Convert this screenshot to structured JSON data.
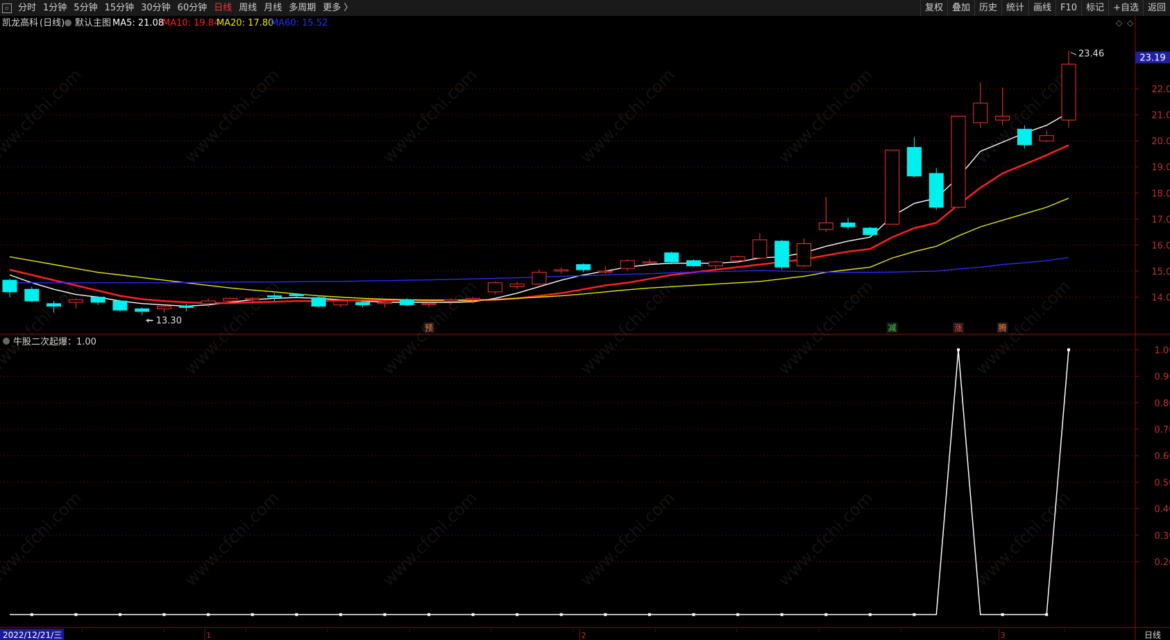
{
  "toolbar": {
    "tabs": [
      "分时",
      "1分钟",
      "5分钟",
      "15分钟",
      "30分钟",
      "60分钟",
      "日线",
      "周线",
      "月线",
      "多周期",
      "更多 〉"
    ],
    "active_tab": "日线",
    "right_buttons": [
      "复权",
      "叠加",
      "历史",
      "统计",
      "画线",
      "F10",
      "标记",
      "+自选",
      "返回"
    ]
  },
  "main_panel": {
    "stock_name": "凯龙高科",
    "period": "(日线)",
    "template_label": "默认主图",
    "ma_labels": [
      {
        "text": "MA5: 21.08",
        "color": "#ffffff"
      },
      {
        "text": "MA10: 19.84",
        "color": "#ff2020"
      },
      {
        "text": "MA20: 17.80",
        "color": "#e8e800"
      },
      {
        "text": "MA60: 15.52",
        "color": "#2a2aff"
      }
    ],
    "current_price_tag": "23.19",
    "high_marker": "23.46",
    "low_marker": "13.30",
    "signals": [
      {
        "text": "预",
        "color": "#ff8040"
      },
      {
        "text": "减",
        "color": "#40d040"
      },
      {
        "text": "涨",
        "color": "#ff4040"
      },
      {
        "text": "腾",
        "color": "#ff8040"
      }
    ]
  },
  "sub_panel": {
    "indicator_label": "牛股二次起爆：1.00"
  },
  "bottom_bar": {
    "date": "2022/12/21/三",
    "month_marks": [
      "1",
      "2",
      "3"
    ],
    "period_label": "日线"
  },
  "watermark": "www.cfchi.com",
  "chart_data": [
    {
      "type": "candlestick",
      "title": "凯龙高科 (日线)",
      "y_axis_ticks": [
        14.0,
        15.0,
        16.0,
        17.0,
        18.0,
        19.0,
        20.0,
        21.0,
        22.0
      ],
      "ylim": [
        13.0,
        24.0
      ],
      "candles": [
        {
          "o": 14.65,
          "h": 14.7,
          "l": 14.0,
          "c": 14.2
        },
        {
          "o": 14.3,
          "h": 14.4,
          "l": 13.8,
          "c": 13.85
        },
        {
          "o": 13.75,
          "h": 13.85,
          "l": 13.4,
          "c": 13.65
        },
        {
          "o": 13.8,
          "h": 13.95,
          "l": 13.55,
          "c": 13.9
        },
        {
          "o": 14.0,
          "h": 14.05,
          "l": 13.7,
          "c": 13.8
        },
        {
          "o": 13.85,
          "h": 13.9,
          "l": 13.45,
          "c": 13.5
        },
        {
          "o": 13.55,
          "h": 13.6,
          "l": 13.3,
          "c": 13.45
        },
        {
          "o": 13.55,
          "h": 13.7,
          "l": 13.4,
          "c": 13.65
        },
        {
          "o": 13.65,
          "h": 13.75,
          "l": 13.45,
          "c": 13.6
        },
        {
          "o": 13.75,
          "h": 13.95,
          "l": 13.6,
          "c": 13.85
        },
        {
          "o": 13.85,
          "h": 13.98,
          "l": 13.75,
          "c": 13.95
        },
        {
          "o": 13.9,
          "h": 14.0,
          "l": 13.75,
          "c": 13.95
        },
        {
          "o": 14.05,
          "h": 14.15,
          "l": 13.85,
          "c": 14.0
        },
        {
          "o": 14.1,
          "h": 14.15,
          "l": 13.95,
          "c": 14.05
        },
        {
          "o": 13.98,
          "h": 14.05,
          "l": 13.6,
          "c": 13.65
        },
        {
          "o": 13.7,
          "h": 13.9,
          "l": 13.6,
          "c": 13.85
        },
        {
          "o": 13.8,
          "h": 13.9,
          "l": 13.6,
          "c": 13.7
        },
        {
          "o": 13.75,
          "h": 13.85,
          "l": 13.6,
          "c": 13.8
        },
        {
          "o": 13.9,
          "h": 13.95,
          "l": 13.65,
          "c": 13.7
        },
        {
          "o": 13.75,
          "h": 13.8,
          "l": 13.6,
          "c": 13.75
        },
        {
          "o": 13.85,
          "h": 13.95,
          "l": 13.7,
          "c": 13.9
        },
        {
          "o": 13.9,
          "h": 14.0,
          "l": 13.75,
          "c": 13.95
        },
        {
          "o": 14.2,
          "h": 14.6,
          "l": 14.1,
          "c": 14.55
        },
        {
          "o": 14.4,
          "h": 14.6,
          "l": 14.3,
          "c": 14.5
        },
        {
          "o": 14.5,
          "h": 15.05,
          "l": 14.45,
          "c": 14.95
        },
        {
          "o": 15.0,
          "h": 15.15,
          "l": 14.9,
          "c": 15.05
        },
        {
          "o": 15.25,
          "h": 15.3,
          "l": 14.95,
          "c": 15.05
        },
        {
          "o": 15.0,
          "h": 15.2,
          "l": 14.9,
          "c": 15.0
        },
        {
          "o": 15.1,
          "h": 15.45,
          "l": 15.0,
          "c": 15.4
        },
        {
          "o": 15.35,
          "h": 15.45,
          "l": 15.25,
          "c": 15.35
        },
        {
          "o": 15.7,
          "h": 15.75,
          "l": 15.25,
          "c": 15.35
        },
        {
          "o": 15.4,
          "h": 15.45,
          "l": 15.15,
          "c": 15.2
        },
        {
          "o": 15.2,
          "h": 15.4,
          "l": 15.1,
          "c": 15.35
        },
        {
          "o": 15.4,
          "h": 15.6,
          "l": 15.3,
          "c": 15.55
        },
        {
          "o": 15.5,
          "h": 16.45,
          "l": 15.45,
          "c": 16.2
        },
        {
          "o": 16.15,
          "h": 16.2,
          "l": 15.05,
          "c": 15.15
        },
        {
          "o": 15.2,
          "h": 16.25,
          "l": 15.15,
          "c": 16.05
        },
        {
          "o": 16.6,
          "h": 17.85,
          "l": 16.5,
          "c": 16.85
        },
        {
          "o": 16.85,
          "h": 17.05,
          "l": 16.6,
          "c": 16.7
        },
        {
          "o": 16.65,
          "h": 16.7,
          "l": 16.35,
          "c": 16.4
        },
        {
          "o": 16.8,
          "h": 19.65,
          "l": 16.8,
          "c": 19.65
        },
        {
          "o": 19.75,
          "h": 20.15,
          "l": 18.6,
          "c": 18.65
        },
        {
          "o": 18.75,
          "h": 18.95,
          "l": 17.35,
          "c": 17.45
        },
        {
          "o": 17.45,
          "h": 20.95,
          "l": 17.4,
          "c": 20.95
        },
        {
          "o": 20.7,
          "h": 22.25,
          "l": 20.5,
          "c": 21.45
        },
        {
          "o": 20.8,
          "h": 22.05,
          "l": 20.6,
          "c": 20.95
        },
        {
          "o": 20.45,
          "h": 20.6,
          "l": 19.7,
          "c": 19.85
        },
        {
          "o": 20.0,
          "h": 20.4,
          "l": 19.95,
          "c": 20.2
        },
        {
          "o": 20.8,
          "h": 23.46,
          "l": 20.5,
          "c": 22.95
        }
      ],
      "series": [
        {
          "name": "MA5",
          "color": "#ffffff",
          "values": [
            14.85,
            14.55,
            14.3,
            14.1,
            14.0,
            13.85,
            13.75,
            13.7,
            13.65,
            13.7,
            13.8,
            13.9,
            13.95,
            13.98,
            13.95,
            13.9,
            13.85,
            13.8,
            13.8,
            13.8,
            13.8,
            13.82,
            13.95,
            14.15,
            14.4,
            14.65,
            14.85,
            15.0,
            15.15,
            15.25,
            15.3,
            15.3,
            15.3,
            15.35,
            15.5,
            15.55,
            15.7,
            15.95,
            16.15,
            16.3,
            17.1,
            17.6,
            17.8,
            18.6,
            19.6,
            19.95,
            20.3,
            20.6,
            21.08
          ]
        },
        {
          "name": "MA10",
          "color": "#ff2020",
          "values": [
            15.05,
            14.85,
            14.65,
            14.45,
            14.25,
            14.05,
            13.92,
            13.85,
            13.8,
            13.77,
            13.77,
            13.8,
            13.82,
            13.85,
            13.85,
            13.88,
            13.88,
            13.88,
            13.88,
            13.88,
            13.88,
            13.88,
            13.9,
            13.95,
            14.05,
            14.15,
            14.3,
            14.45,
            14.55,
            14.7,
            14.85,
            14.95,
            15.05,
            15.15,
            15.25,
            15.35,
            15.45,
            15.6,
            15.75,
            15.85,
            16.3,
            16.65,
            16.85,
            17.55,
            18.2,
            18.75,
            19.1,
            19.45,
            19.84
          ]
        },
        {
          "name": "MA20",
          "color": "#e8e800",
          "values": [
            15.55,
            15.4,
            15.25,
            15.1,
            14.95,
            14.85,
            14.75,
            14.65,
            14.55,
            14.45,
            14.35,
            14.27,
            14.2,
            14.12,
            14.05,
            14.0,
            13.95,
            13.92,
            13.9,
            13.88,
            13.88,
            13.88,
            13.9,
            13.95,
            14.0,
            14.05,
            14.12,
            14.2,
            14.28,
            14.35,
            14.4,
            14.45,
            14.5,
            14.55,
            14.6,
            14.7,
            14.8,
            14.95,
            15.05,
            15.15,
            15.5,
            15.75,
            15.95,
            16.35,
            16.7,
            16.95,
            17.2,
            17.45,
            17.8
          ]
        },
        {
          "name": "MA60",
          "color": "#2a2aff",
          "values": [
            14.55,
            14.55,
            14.55,
            14.55,
            14.55,
            14.55,
            14.55,
            14.55,
            14.56,
            14.57,
            14.58,
            14.58,
            14.58,
            14.59,
            14.6,
            14.6,
            14.62,
            14.63,
            14.65,
            14.66,
            14.68,
            14.7,
            14.72,
            14.74,
            14.77,
            14.8,
            14.82,
            14.85,
            14.88,
            14.9,
            14.93,
            14.96,
            14.98,
            15.0,
            15.02,
            15.0,
            14.98,
            14.96,
            14.95,
            14.95,
            14.96,
            14.98,
            15.0,
            15.08,
            15.15,
            15.25,
            15.32,
            15.4,
            15.52
          ]
        }
      ]
    },
    {
      "type": "line",
      "title": "牛股二次起爆：1.00",
      "y_axis_ticks": [
        0.2,
        0.3,
        0.4,
        0.5,
        0.6,
        0.7,
        0.8,
        0.9,
        1.0
      ],
      "ylim": [
        -0.02,
        1.03
      ],
      "series": [
        {
          "name": "牛股二次起爆",
          "color": "#ffffff",
          "values": [
            0,
            0,
            0,
            0,
            0,
            0,
            0,
            0,
            0,
            0,
            0,
            0,
            0,
            0,
            0,
            0,
            0,
            0,
            0,
            0,
            0,
            0,
            0,
            0,
            0,
            0,
            0,
            0,
            0,
            0,
            0,
            0,
            0,
            0,
            0,
            0,
            0,
            0,
            0,
            0,
            0,
            0,
            0,
            1,
            0,
            0,
            0,
            0,
            1
          ]
        }
      ]
    }
  ]
}
